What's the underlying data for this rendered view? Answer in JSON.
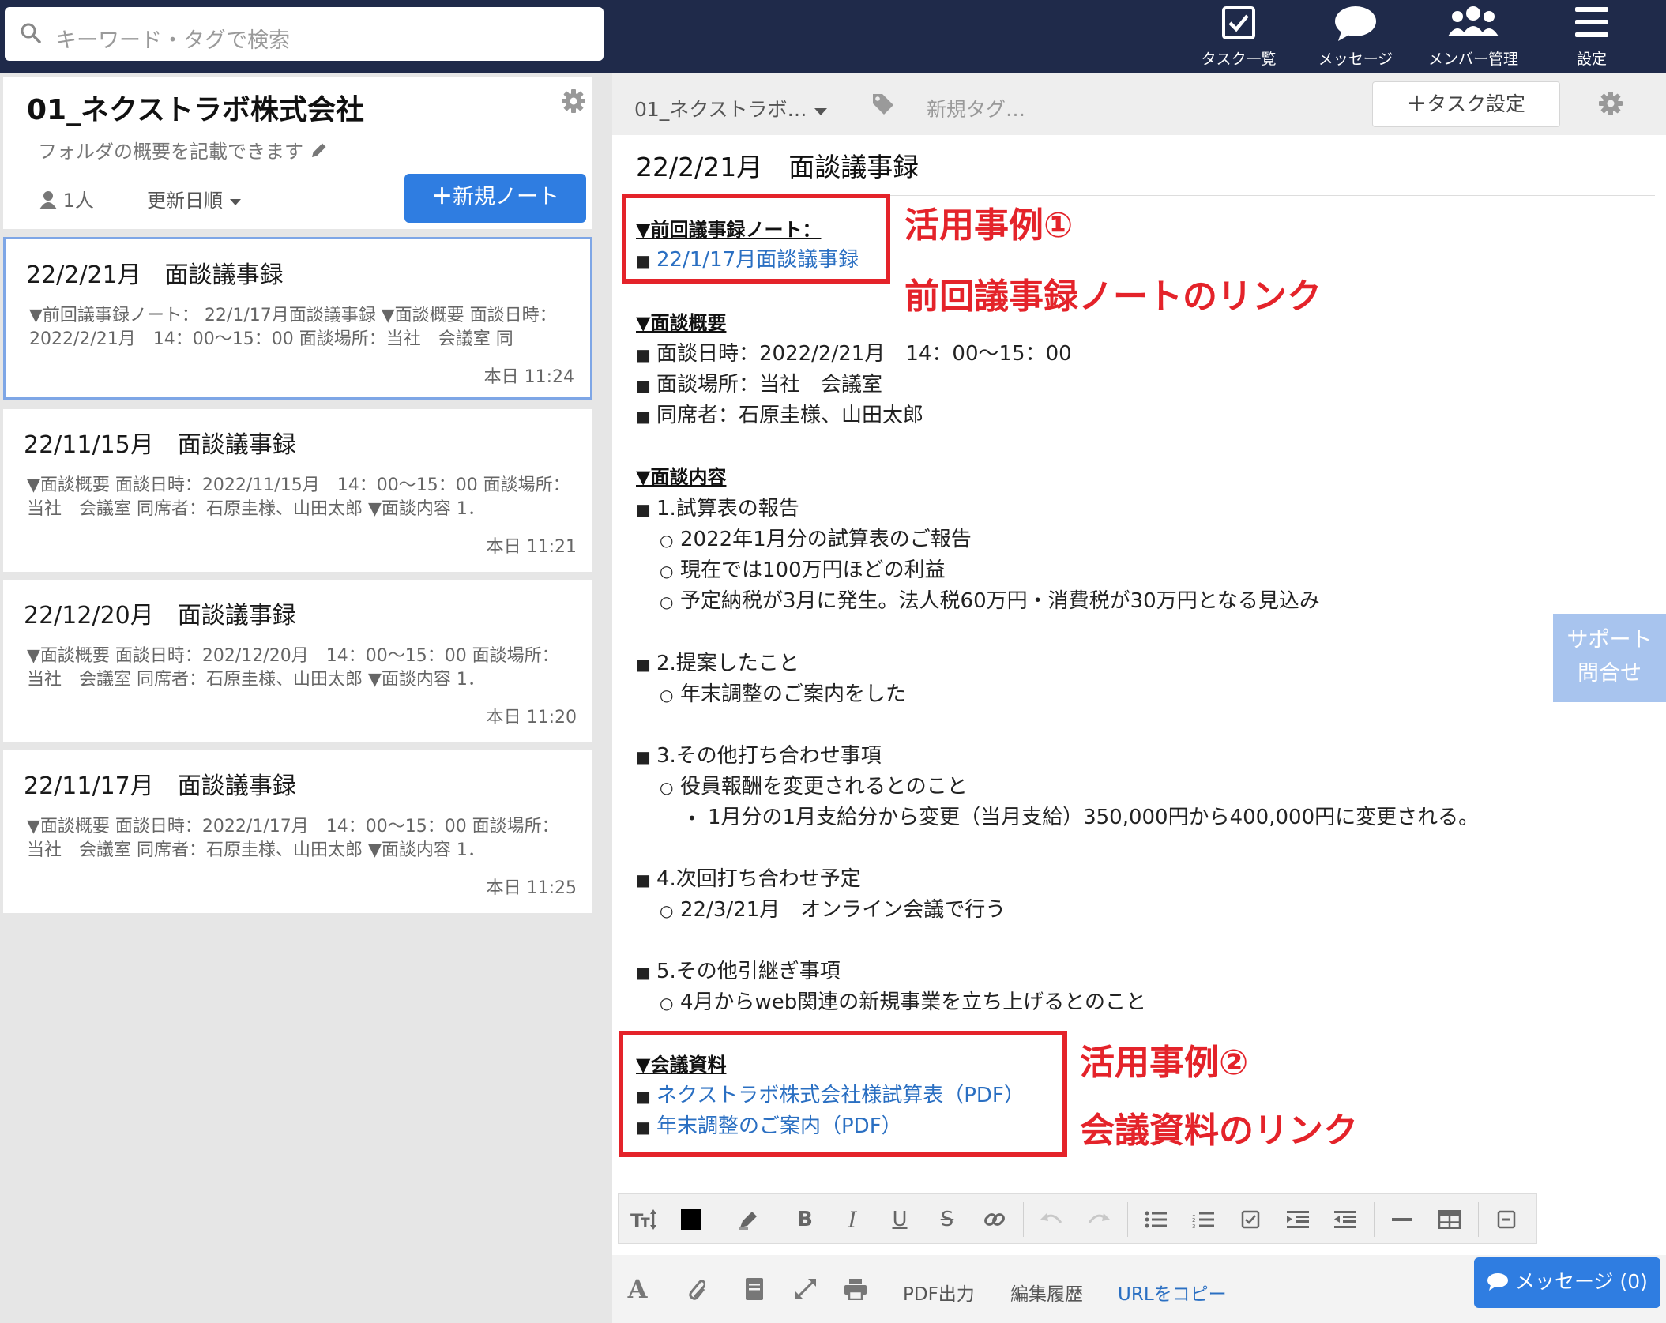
{
  "search": {
    "placeholder": "キーワード・タグで検索"
  },
  "nav": {
    "tasks": "タスク一覧",
    "messages": "メッセージ",
    "members": "メンバー管理",
    "settings": "設定"
  },
  "folder": {
    "title": "01_ネクストラボ株式会社",
    "description": "フォルダの概要を記載できます",
    "member_count": "1人",
    "sort": "更新日順",
    "new_note": "新規ノート"
  },
  "notes": [
    {
      "title": "22/2/21月　面談議事録",
      "snippet": "▼前回議事録ノート： 22/1/17月面談議事録 ▼面談概要 面談日時：2022/2/21月　14：00〜15：00 面談場所：当社　会議室 同",
      "time": "本日 11:24"
    },
    {
      "title": "22/11/15月　面談議事録",
      "snippet": "▼面談概要 面談日時：2022/11/15月　14：00〜15：00 面談場所：当社　会議室 同席者：石原圭様、山田太郎 ▼面談内容 1．",
      "time": "本日 11:21"
    },
    {
      "title": "22/12/20月　面談議事録",
      "snippet": "▼面談概要 面談日時：202/12/20月　14：00〜15：00 面談場所：当社　会議室 同席者：石原圭様、山田太郎 ▼面談内容 1．",
      "time": "本日 11:20"
    },
    {
      "title": "22/11/17月　面談議事録",
      "snippet": "▼面談概要 面談日時：2022/1/17月　14：00〜15：00 面談場所：当社　会議室 同席者：石原圭様、山田太郎 ▼面談内容 1．",
      "time": "本日 11:25"
    }
  ],
  "editor": {
    "breadcrumb": "01_ネクストラボ…",
    "tag_placeholder": "新規タグ…",
    "task_setting": "タスク設定",
    "title": "22/2/21月　面談議事録",
    "prev_heading": "▼前回議事録ノート：",
    "prev_link": "22/1/17月面談議事録",
    "overview_heading": "▼面談概要",
    "overview_items": [
      "面談日時：2022/2/21月　14：00〜15：00",
      "面談場所：当社　会議室",
      "同席者：石原圭様、山田太郎"
    ],
    "content_heading": "▼面談内容",
    "item1": "1.試算表の報告",
    "item1_subs": [
      "2022年1月分の試算表のご報告",
      "現在では100万円ほどの利益",
      "予定納税が3月に発生。法人税60万円・消費税が30万円となる見込み"
    ],
    "item2": "2.提案したこと",
    "item2_sub": "年末調整のご案内をした",
    "item3": "3.その他打ち合わせ事項",
    "item3_sub": "役員報酬を変更されるとのこと",
    "item3_subsub": "1月分の1月支給分から変更（当月支給）350,000円から400,000円に変更される。",
    "item4": "4.次回打ち合わせ予定",
    "item4_sub": "22/3/21月　オンライン会議で行う",
    "item5": "5.その他引継ぎ事項",
    "item5_sub": "4月からweb関連の新規事業を立ち上げるとのこと",
    "materials_heading": "▼会議資料",
    "materials": [
      "ネクストラボ株式会社様試算表（PDF）",
      "年末調整のご案内（PDF）"
    ]
  },
  "annotations": {
    "case1_title": "活用事例①",
    "case1_desc": "前回議事録ノートのリンク",
    "case2_title": "活用事例②",
    "case2_desc": "会議資料のリンク"
  },
  "support": {
    "line1": "サポート",
    "line2": "問合せ"
  },
  "actions": {
    "pdf": "PDF出力",
    "history": "編集履歴",
    "copy_url": "URLをコピー",
    "message": "メッセージ (0)"
  },
  "colors": {
    "topbar": "#1f2a4a",
    "accent": "#2f7de1",
    "annotation": "#e4232a",
    "link": "#2a6fc2"
  }
}
